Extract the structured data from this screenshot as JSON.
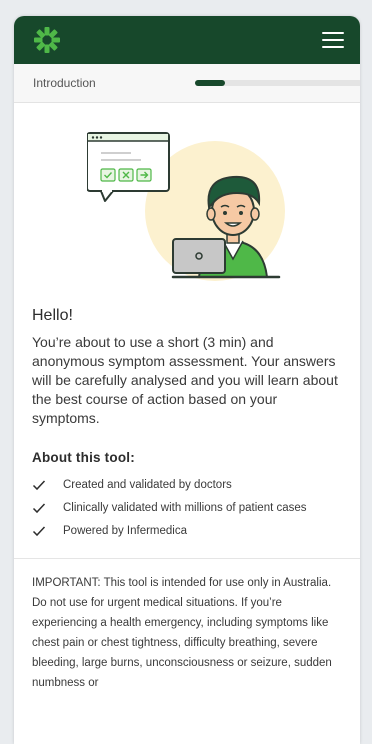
{
  "header": {
    "logo_icon": "infermedica-logo-icon",
    "menu_icon": "hamburger-menu-icon",
    "background_color": "#17482b"
  },
  "progress": {
    "label": "Introduction",
    "value": 0.18
  },
  "main": {
    "illustration_icon": "doctor-with-laptop-illustration",
    "greeting": "Hello!",
    "intro": "You’re about to use a short (3 min) and anonymous symptom assessment. Your answers will be carefully analysed and you will learn about the best course of action based on your symptoms.",
    "about_title": "About this tool:",
    "features": [
      {
        "icon": "check-icon",
        "text": "Created and validated by doctors"
      },
      {
        "icon": "check-icon",
        "text": "Clinically validated with millions of patient cases"
      },
      {
        "icon": "check-icon",
        "text": "Powered by Infermedica"
      }
    ],
    "important": "IMPORTANT: This tool is intended for use only in Australia. Do not use for urgent medical situations. If you’re experiencing a health emergency, including symptoms like chest pain or chest tightness, difficulty breathing, severe bleeding, large burns, unconsciousness or seizure, sudden numbness or"
  },
  "colors": {
    "accent_green": "#4fb848",
    "dark_green": "#17482b"
  }
}
